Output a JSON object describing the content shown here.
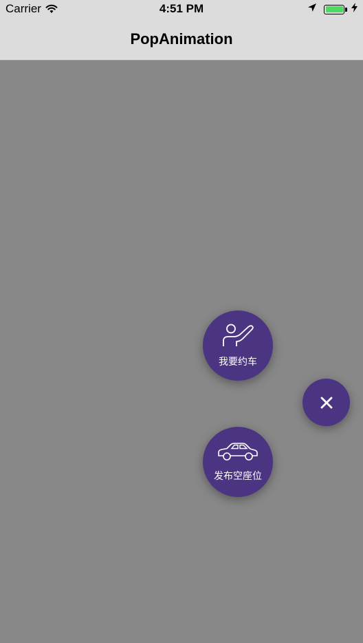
{
  "status_bar": {
    "carrier": "Carrier",
    "time": "4:51 PM",
    "battery_color": "#4cd964"
  },
  "nav": {
    "title": "PopAnimation"
  },
  "menu": {
    "button_color": "#4b3583",
    "background_color": "#888888",
    "items": [
      {
        "label": "我要约车",
        "icon": "raise-hand-person-icon"
      },
      {
        "label": "发布空座位",
        "icon": "car-icon"
      }
    ],
    "close_icon": "close-icon"
  }
}
